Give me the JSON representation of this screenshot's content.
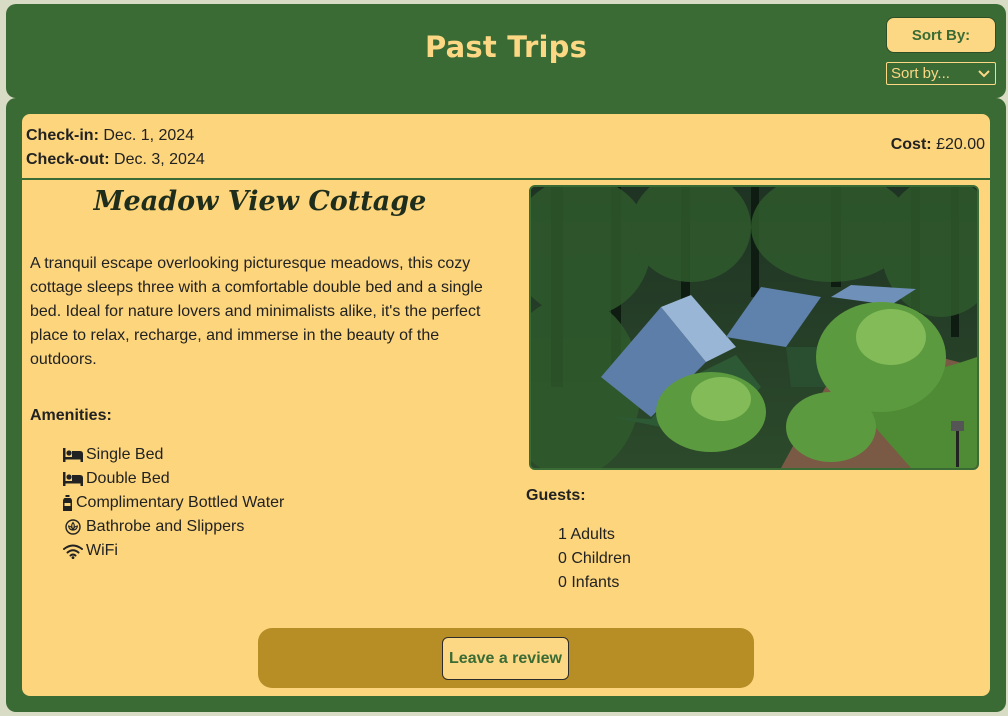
{
  "header": {
    "title": "Past Trips",
    "sort_button_label": "Sort By:",
    "sort_select_value": "Sort by..."
  },
  "booking": {
    "checkin_label": "Check-in:",
    "checkin_value": "Dec. 1, 2024",
    "checkout_label": "Check-out:",
    "checkout_value": "Dec. 3, 2024",
    "cost_label": "Cost:",
    "cost_value": "£20.00"
  },
  "property": {
    "name": "Meadow View Cottage",
    "description": "A tranquil escape overlooking picturesque meadows, this cozy cottage sleeps three with a comfortable double bed and a single bed. Ideal for nature lovers and minimalists alike, it's the perfect place to relax, recharge, and immerse in the beauty of the outdoors.",
    "amenities_heading": "Amenities:",
    "amenities": [
      {
        "icon": "bed-icon",
        "label": "Single Bed"
      },
      {
        "icon": "bed-icon",
        "label": "Double Bed"
      },
      {
        "icon": "bottle-icon",
        "label": "Complimentary Bottled Water"
      },
      {
        "icon": "spa-icon",
        "label": "Bathrobe and Slippers"
      },
      {
        "icon": "wifi-icon",
        "label": "WiFi"
      }
    ]
  },
  "guests": {
    "heading": "Guests:",
    "adults": "1 Adults",
    "children": "0 Children",
    "infants": "0 Infants"
  },
  "review": {
    "button_label": "Leave a review"
  },
  "colors": {
    "primary_green": "#3a6b35",
    "card_yellow": "#fcd57c",
    "accent_gold": "#b78d26"
  }
}
